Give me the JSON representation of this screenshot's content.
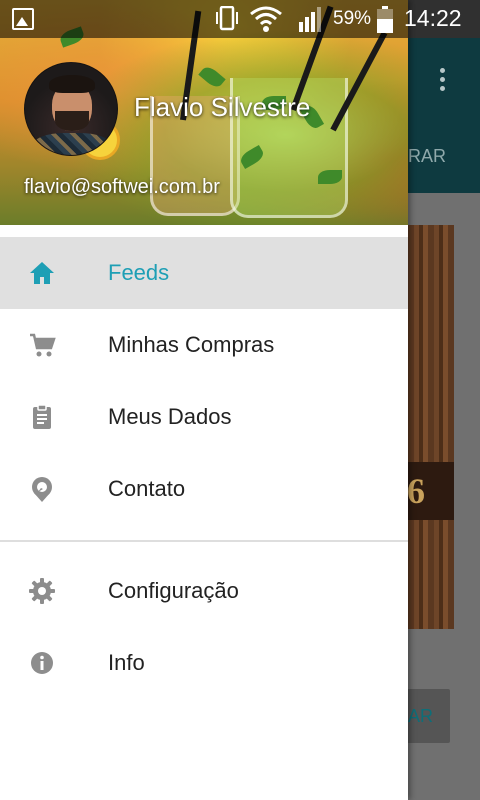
{
  "status_bar": {
    "battery_percent": "59%",
    "time": "14:22",
    "icons": [
      "gallery-icon",
      "vibrate-icon",
      "wifi-icon",
      "signal-icon",
      "battery-icon"
    ]
  },
  "background_app": {
    "tab_label_partial": "RAR",
    "card_text_partial": "6",
    "button_label_partial": "AR"
  },
  "drawer": {
    "user": {
      "name": "Flavio Silvestre",
      "email": "flavio@softwei.com.br"
    },
    "menu_primary": [
      {
        "label": "Feeds",
        "icon": "home-icon",
        "active": true
      },
      {
        "label": "Minhas Compras",
        "icon": "cart-icon",
        "active": false
      },
      {
        "label": "Meus Dados",
        "icon": "clipboard-icon",
        "active": false
      },
      {
        "label": "Contato",
        "icon": "location-icon",
        "active": false
      }
    ],
    "menu_secondary": [
      {
        "label": "Configuração",
        "icon": "gear-icon",
        "active": false
      },
      {
        "label": "Info",
        "icon": "info-icon",
        "active": false
      }
    ]
  },
  "colors": {
    "accent": "#1e9fb5",
    "active_row_bg": "#e0e0e0",
    "icon_gray": "#8d8d8d",
    "toolbar": "#0e3a40"
  }
}
